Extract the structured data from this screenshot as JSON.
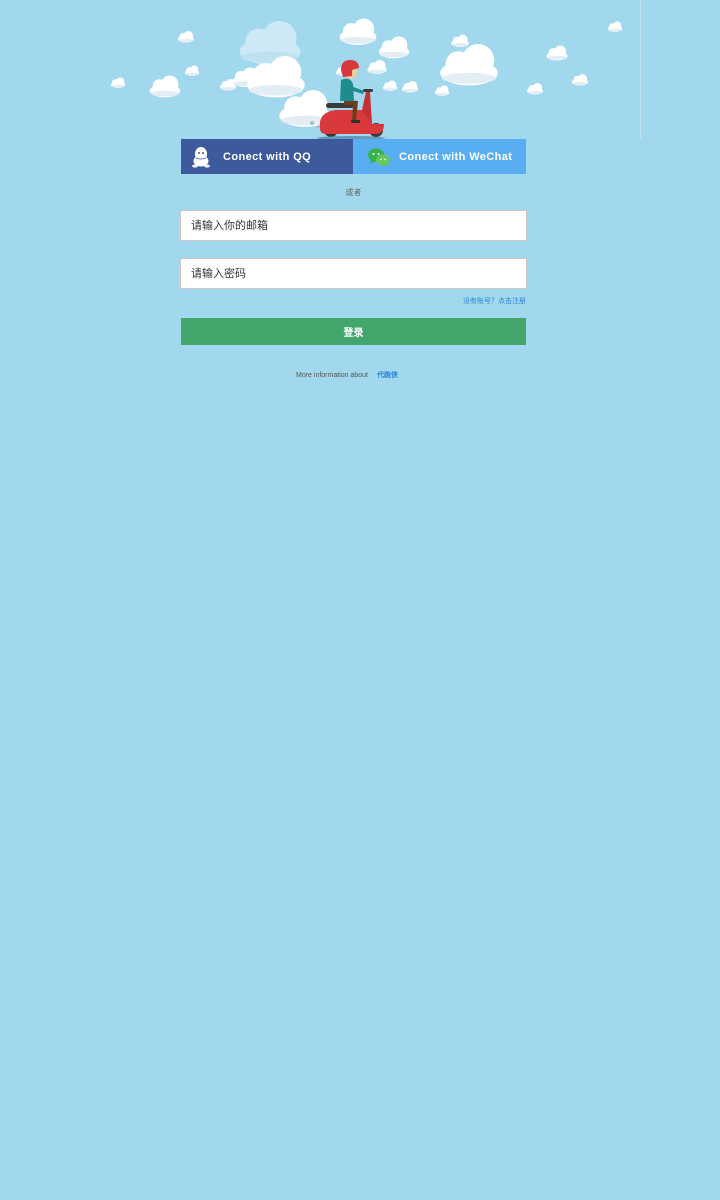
{
  "social": {
    "qq_label": "Conect with  QQ",
    "wechat_label": "Conect with  WeChat"
  },
  "divider_text": "或者",
  "form": {
    "email_placeholder": "请输入你的邮箱",
    "password_placeholder": "请输入密码",
    "register_link": "没有账号？点击注册",
    "login_label": "登录"
  },
  "footer": {
    "text": "More information about",
    "link": "代跑侠"
  },
  "colors": {
    "background": "#a2d8ee",
    "qq": "#3d5a9c",
    "wechat": "#58aef0",
    "login": "#43a66c",
    "link": "#2a84d6",
    "scooter": "#d9393b"
  },
  "icons": [
    "qq-penguin-icon",
    "wechat-icon",
    "scooter-rider-illustration",
    "cloud-icon"
  ]
}
